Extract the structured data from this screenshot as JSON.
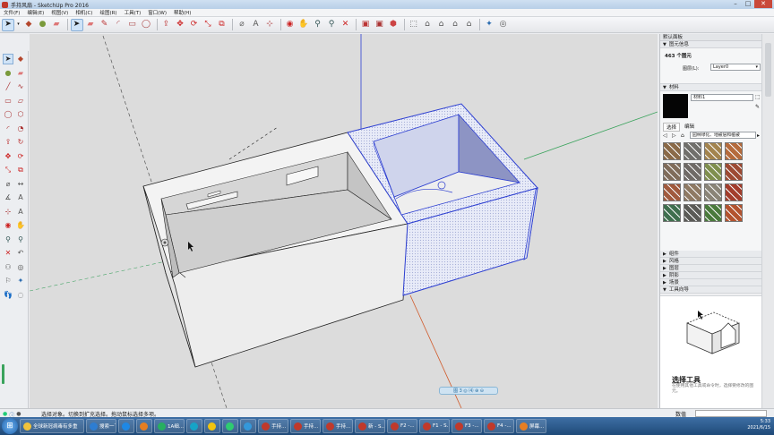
{
  "window": {
    "title": "手持风扇 - SketchUp Pro 2016"
  },
  "menu": [
    "文件(F)",
    "编辑(E)",
    "视图(V)",
    "相机(C)",
    "绘图(R)",
    "工具(T)",
    "窗口(W)",
    "帮助(H)"
  ],
  "toolbar": {
    "icons": [
      "select-icon",
      "dropdown-icon",
      "component-icon",
      "paint-bucket-icon",
      "eraser-icon",
      "select-arrow-icon",
      "eraser-2-icon",
      "pencil-icon",
      "arc-icon",
      "rectangle-icon",
      "circle-icon",
      "push-pull-icon",
      "move-icon",
      "rotate-icon",
      "scale-icon",
      "offset-icon",
      "tape-measure-icon",
      "text-icon",
      "axes-icon",
      "orbit-icon",
      "pan-icon",
      "zoom-icon",
      "zoom-window-icon",
      "zoom-extents-icon",
      "warehouse-icon",
      "extension-warehouse-icon",
      "iso-view-icon",
      "top-view-icon",
      "front-view-icon",
      "right-view-icon",
      "back-view-icon",
      "left-view-icon",
      "section-plane-icon",
      "style-icon"
    ]
  },
  "left_tools": [
    "select-tool-icon",
    "make-component-icon",
    "paint-bucket-icon",
    "eraser-icon",
    "line-tool-icon",
    "freehand-icon",
    "rectangle-icon",
    "rotated-rectangle-icon",
    "circle-icon",
    "polygon-icon",
    "arc-icon",
    "pie-icon",
    "push-pull-icon",
    "follow-me-icon",
    "move-icon",
    "rotate-icon",
    "scale-icon",
    "offset-icon",
    "tape-measure-icon",
    "dimension-icon",
    "protractor-icon",
    "text-icon",
    "axes-icon",
    "3d-text-icon",
    "orbit-icon",
    "pan-icon",
    "zoom-icon",
    "zoom-window-icon",
    "zoom-extents-icon",
    "previous-view-icon",
    "walk-icon",
    "look-around-icon",
    "position-camera-icon",
    "section-plane-icon",
    "footprints-icon",
    "hide-icon"
  ],
  "panel": {
    "title": "默认面板",
    "entity_info": {
      "header": "图元信息",
      "count": "463 个图元",
      "layer_label": "图层(L):",
      "layer_value": "Layer0"
    },
    "materials": {
      "header": "材料",
      "name": "材料1",
      "tabs": [
        "选择",
        "编辑"
      ],
      "category": "园林绿化、地被层和植被",
      "swatch_colors": [
        "#8a6a48",
        "#706f6b",
        "#a3844e",
        "#b56b3c",
        "#806c5a",
        "#6f6a66",
        "#7f8f4e",
        "#9d4a33",
        "#a15a3d",
        "#8f7a63",
        "#8a8477",
        "#a33d2c",
        "#3f6f4e",
        "#5a5a56",
        "#4a7a3c",
        "#b3532f"
      ]
    },
    "sections": [
      "组件",
      "风格",
      "图层",
      "阴影",
      "场景",
      "工具向导"
    ],
    "instructor": {
      "tool_name": "选择工具",
      "desc": "在使用其他工具或命令时，选择要修改的图元。"
    }
  },
  "scene": {
    "badge_label": "图 3 ◎ ⑷ ⊕ ⊖"
  },
  "status": {
    "text": "选择对象。切换到扩充选择。拖动鼠标选择多项。",
    "measure_label": "数值"
  },
  "taskbar": {
    "start_label": "⊞",
    "items": [
      {
        "label": "全球新冠病毒有多重",
        "color": "#f0c23b"
      },
      {
        "label": "搜索一下",
        "color": "#2d7dd2"
      },
      {
        "label": "",
        "color": "#1e88e5"
      },
      {
        "label": "",
        "color": "#e67e22"
      },
      {
        "label": "1A细...",
        "color": "#27ae60"
      },
      {
        "label": "",
        "color": "#16a3c7"
      },
      {
        "label": "",
        "color": "#f1c40f"
      },
      {
        "label": "",
        "color": "#2ecc71"
      },
      {
        "label": "",
        "color": "#3498db"
      },
      {
        "label": "手持...",
        "color": "#c0392b"
      },
      {
        "label": "手持...",
        "color": "#c0392b"
      },
      {
        "label": "手持...",
        "color": "#c0392b"
      },
      {
        "label": "新 - S...",
        "color": "#c0392b"
      },
      {
        "label": "F2 -...",
        "color": "#c0392b"
      },
      {
        "label": "F1 - S...",
        "color": "#c0392b"
      },
      {
        "label": "F3 -...",
        "color": "#c0392b"
      },
      {
        "label": "F4 -...",
        "color": "#c0392b"
      },
      {
        "label": "屏幕...",
        "color": "#e67e22"
      }
    ],
    "time": "5:33",
    "date": "2021/6/15"
  }
}
